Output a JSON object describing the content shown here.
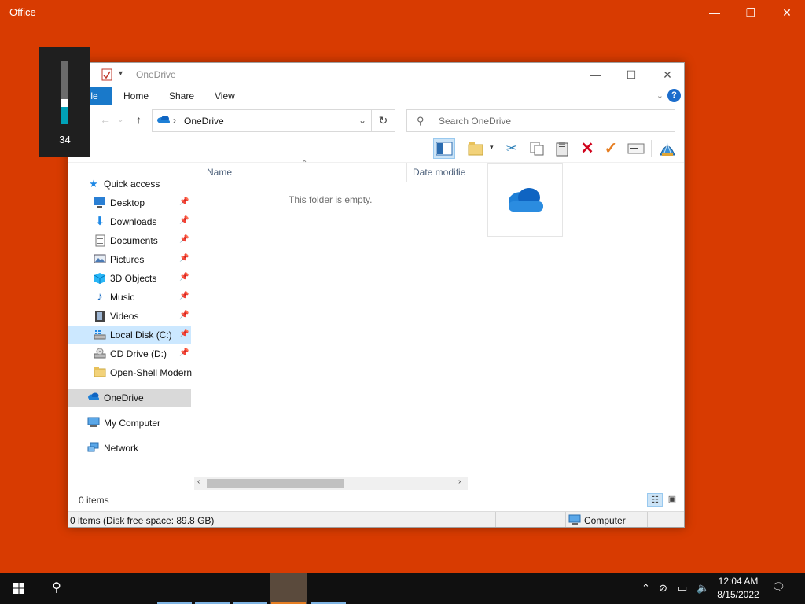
{
  "office": {
    "title": "Office",
    "minimize": "—",
    "restore": "❐",
    "close": "✕"
  },
  "volume": {
    "value": "34",
    "level": 0.34
  },
  "explorer": {
    "title": "OneDrive",
    "controls": {
      "minimize": "—",
      "maximize": "☐",
      "close": "✕"
    },
    "tabs": {
      "file": "File",
      "home": "Home",
      "share": "Share",
      "view": "View"
    },
    "help": "?",
    "nav": {
      "back": "←",
      "forward": "→",
      "recent": "⌄",
      "up": "↑",
      "refresh": "↻"
    },
    "address": {
      "path": "OneDrive"
    },
    "search": {
      "placeholder": "Search OneDrive"
    },
    "columns": {
      "name": "Name",
      "date": "Date modifie"
    },
    "empty_message": "This folder is empty.",
    "sidebar": {
      "quick_access": "Quick access",
      "items": [
        {
          "label": "Desktop",
          "pinned": true
        },
        {
          "label": "Downloads",
          "pinned": true
        },
        {
          "label": "Documents",
          "pinned": true
        },
        {
          "label": "Pictures",
          "pinned": true
        },
        {
          "label": "3D Objects",
          "pinned": true
        },
        {
          "label": "Music",
          "pinned": true
        },
        {
          "label": "Videos",
          "pinned": true
        },
        {
          "label": "Local Disk (C:)",
          "pinned": true
        },
        {
          "label": "CD Drive (D:)",
          "pinned": true
        },
        {
          "label": "Open-Shell Modern",
          "pinned": false
        }
      ],
      "onedrive": "OneDrive",
      "my_computer": "My Computer",
      "network": "Network"
    },
    "items_count": "0 items",
    "status": {
      "left": "0 items (Disk free space: 89.8 GB)",
      "right": "Computer"
    }
  },
  "taskbar": {
    "clock_time": "12:04 AM",
    "clock_date": "8/15/2022"
  },
  "colors": {
    "desktop": "#d83b01",
    "accent": "#1979ca",
    "taskbar": "#101010"
  }
}
